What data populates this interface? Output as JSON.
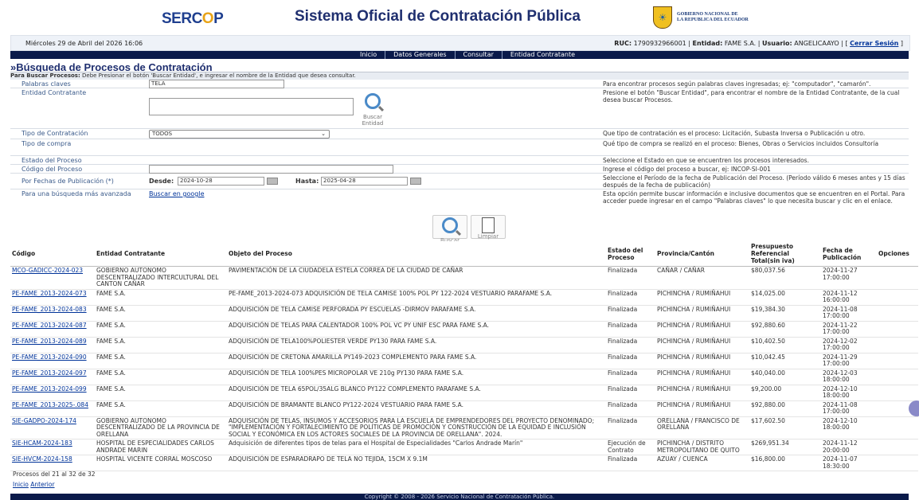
{
  "header": {
    "logo_pre": "SERC",
    "logo_o": "O",
    "logo_post": "P",
    "title": "Sistema Oficial de Contratación Pública",
    "gov_line1": "GOBIERNO NACIONAL DE",
    "gov_line2": "LA REPUBLICA DEL ECUADOR"
  },
  "infobar": {
    "date": "Miércoles 29 de Abril del 2026 16:06",
    "ruc_label": "RUC:",
    "ruc": "1790932966001",
    "entidad_label": "Entidad:",
    "entidad": "FAME S.A.",
    "usuario_label": "Usuario:",
    "usuario": "ANGELICAAYO",
    "logout": "Cerrar Sesión"
  },
  "nav": [
    "Inicio",
    "Datos Generales",
    "Consultar",
    "Entidad Contratante"
  ],
  "page_title": "»Búsqueda de Procesos de Contratación",
  "instructions": {
    "bold": "Para Buscar Procesos:",
    "text": " Debe Presionar el botón 'Buscar Entidad', e ingresar el nombre de la Entidad que desea consultar."
  },
  "form": {
    "palabras": {
      "label": "Palabras claves",
      "value": "TELA",
      "help": "Para encontrar procesos según palabras claves ingresadas; ej: \"computador\", \"camarón\"."
    },
    "entidad": {
      "label": "Entidad Contratante",
      "button": "Buscar Entidad",
      "help": "Presione el botón \"Buscar Entidad\", para encontrar el nombre de la Entidad Contratante, de la cual desea buscar Procesos."
    },
    "tipo_contratacion": {
      "label": "Tipo de Contratación",
      "value": "TODOS",
      "help": "Que tipo de contratación es el proceso: Licitación, Subasta Inversa o Publicación u otro."
    },
    "tipo_compra": {
      "label": "Tipo de compra",
      "help": "Qué tipo de compra se realizó en el proceso: Bienes, Obras o Servicios incluidos Consultoría"
    },
    "estado": {
      "label": "Estado del Proceso",
      "help": "Seleccione el Estado en que se encuentren los procesos interesados."
    },
    "codigo": {
      "label": "Código del Proceso",
      "help": "Ingrese el código del proceso a buscar, ej: INCOP-SI-001"
    },
    "fechas": {
      "label": "Por Fechas de Publicación (*)",
      "desde_label": "Desde:",
      "desde": "2024-10-28",
      "hasta_label": "Hasta:",
      "hasta": "2025-04-28",
      "help": "Seleccione el Período de la fecha de Publicación del Proceso. (Período válido 6 meses antes y 15 días después de la fecha de publicación)"
    },
    "avanzada": {
      "label": "Para una búsqueda más avanzada",
      "link": "Buscar en google",
      "help": "Esta opción permite buscar información e inclusive documentos que se encuentren en el Portal. Para acceder puede ingresar en el campo \"Palabras claves\" lo que necesita buscar y clic en el enlace."
    }
  },
  "buttons": {
    "buscar": "Buscar",
    "limpiar": "Limpiar"
  },
  "table": {
    "headers": [
      "Código",
      "Entidad Contratante",
      "Objeto del Proceso",
      "Estado del Proceso",
      "Provincia/Cantón",
      "Presupuesto Referencial Total(sin iva)",
      "Fecha de Publicación",
      "Opciones"
    ],
    "rows": [
      [
        "MCO-GADICC-2024-023",
        "GOBIERNO AUTONOMO DESCENTRALIZADO INTERCULTURAL DEL CANTON CAÑAR",
        "PAVIMENTACIÓN DE LA CIUDADELA ESTELA CORREA DE LA CIUDAD DE CAÑAR",
        "Finalizada",
        "CAÑAR / CAÑAR",
        "$80,037.56",
        "2024-11-27 17:00:00"
      ],
      [
        "PE-FAME_2013-2024-073",
        "FAME S.A.",
        "PE-FAME_2013-2024-073 ADQUISICIÓN DE TELA CAMISE 100% POL PY 122-2024 VESTUARIO PARAFAME S.A.",
        "Finalizada",
        "PICHINCHA / RUMIÑAHUI",
        "$14,025.00",
        "2024-11-12 16:00:00"
      ],
      [
        "PE-FAME_2013-2024-083",
        "FAME S.A.",
        "ADQUISICIÓN DE TELA CAMISE PERFORADA PY ESCUELAS -DIRMOV PARAFAME S.A.",
        "Finalizada",
        "PICHINCHA / RUMIÑAHUI",
        "$19,384.30",
        "2024-11-08 17:00:00"
      ],
      [
        "PE-FAME_2013-2024-087",
        "FAME S.A.",
        "ADQUISICIÓN DE TELAS PARA CALENTADOR 100% POL VC PY UNIF ESC PARA FAME S.A.",
        "Finalizada",
        "PICHINCHA / RUMIÑAHUI",
        "$92,880.60",
        "2024-11-22 17:00:00"
      ],
      [
        "PE-FAME_2013-2024-089",
        "FAME S.A.",
        "ADQUISICIÓN DE TELA100%POLIESTER VERDE PY130 PARA FAME S.A.",
        "Finalizada",
        "PICHINCHA / RUMIÑAHUI",
        "$10,402.50",
        "2024-12-02 17:00:00"
      ],
      [
        "PE-FAME_2013-2024-090",
        "FAME S.A.",
        "ADQUISICIÓN DE CRETONA AMARILLA PY149-2023 COMPLEMENTO PARA FAME S.A.",
        "Finalizada",
        "PICHINCHA / RUMIÑAHUI",
        "$10,042.45",
        "2024-11-29 17:00:00"
      ],
      [
        "PE-FAME_2013-2024-097",
        "FAME S.A.",
        "ADQUISICIÓN DE TELA 100%PES MICROPOLAR VE 210g PY130 PARA FAME S.A.",
        "Finalizada",
        "PICHINCHA / RUMIÑAHUI",
        "$40,040.00",
        "2024-12-03 18:00:00"
      ],
      [
        "PE-FAME_2013-2024-099",
        "FAME S.A.",
        "ADQUISICIÓN DE TELA 65POL/35ALG BLANCO PY122 COMPLEMENTO PARAFAME S.A.",
        "Finalizada",
        "PICHINCHA / RUMIÑAHUI",
        "$9,200.00",
        "2024-12-10 18:00:00"
      ],
      [
        "PE-FAME_2013-2025-.084",
        "FAME S.A.",
        "ADQUISICIÓN DE BRAMANTE BLANCO PY122-2024 VESTUARIO PARA FAME S.A.",
        "Finalizada",
        "PICHINCHA / RUMIÑAHUI",
        "$92,880.00",
        "2024-11-08 17:00:00"
      ],
      [
        "SIE-GADPO-2024-174",
        "GOBIERNO AUTONOMO DESCENTRALIZADO DE LA PROVINCIA DE ORELLANA",
        "ADQUISICIÓN DE TELAS, INSUMOS Y ACCESORIOS PARA LA ESCUELA DE EMPRENDEDORES DEL PROYECTO DENOMINADO; \"IMPLEMENTACIÓN Y FORTALECIMIENTO DE POLÍTICAS DE PROMOCIÓN Y CONSTRUCCIÓN DE LA EQUIDAD E INCLUSIÓN SOCIAL Y ECONÓMICA EN LOS ACTORES SOCIALES DE LA PROVINCIA DE ORELLANA\". 2024.",
        "Finalizada",
        "ORELLANA / FRANCISCO DE ORELLANA",
        "$17,602.50",
        "2024-12-10 18:00:00"
      ],
      [
        "SIE-HCAM-2024-183",
        "HOSPITAL DE ESPECIALIDADES CARLOS ANDRADE MARIN",
        "Adquisición de diferentes tipos de telas para el Hospital de Especialidades \"Carlos Andrade Marín\"",
        "Ejecución de Contrato",
        "PICHINCHA / DISTRITO METROPOLITANO DE QUITO",
        "$269,951.34",
        "2024-11-12 20:00:00"
      ],
      [
        "SIE-HVCM-2024-158",
        "HOSPITAL VICENTE CORRAL MOSCOSO",
        "ADQUISICIÓN DE ESPARADRAPO DE TELA NO TEJIDA, 15CM X 9.1M",
        "Finalizada",
        "AZUAY / CUENCA",
        "$16,800.00",
        "2024-11-07 18:30:00"
      ]
    ]
  },
  "pager": {
    "info": "Procesos del 21 al 32 de 32",
    "inicio": "Inicio",
    "anterior": "Anterior"
  },
  "footer": "Copyright © 2008 - 2026 Servicio Nacional de Contratación Pública."
}
